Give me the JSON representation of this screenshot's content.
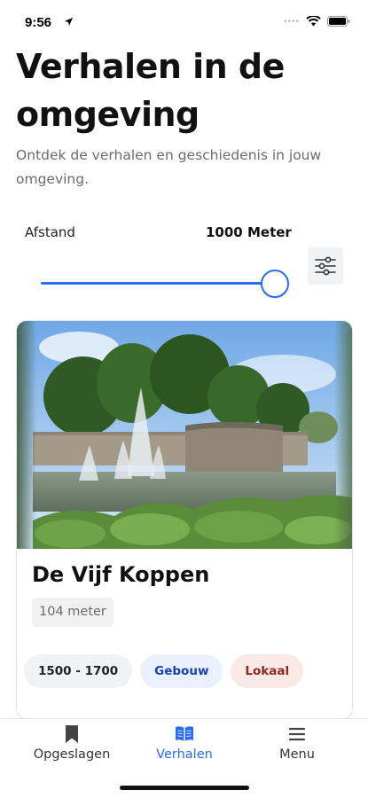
{
  "status_bar": {
    "time": "9:56"
  },
  "header": {
    "title": "Verhalen in de omgeving",
    "subtitle": "Ontdek de verhalen en geschiedenis in jouw omgeving."
  },
  "distance_filter": {
    "label": "Afstand",
    "value_text": "1000 Meter",
    "slider_level": 1.0,
    "accent_color": "#2a6df4"
  },
  "story_card": {
    "image_icon": "fountain-castle-photo",
    "title": "De Vijf Koppen",
    "distance": "104 meter",
    "tags": [
      {
        "label": "1500 - 1700"
      },
      {
        "label": "Gebouw"
      },
      {
        "label": "Lokaal"
      }
    ]
  },
  "tabbar": {
    "items": [
      {
        "label": "Opgeslagen",
        "icon": "bookmark-icon",
        "active": false
      },
      {
        "label": "Verhalen",
        "icon": "book-icon",
        "active": true
      },
      {
        "label": "Menu",
        "icon": "menu-icon",
        "active": false
      }
    ]
  }
}
